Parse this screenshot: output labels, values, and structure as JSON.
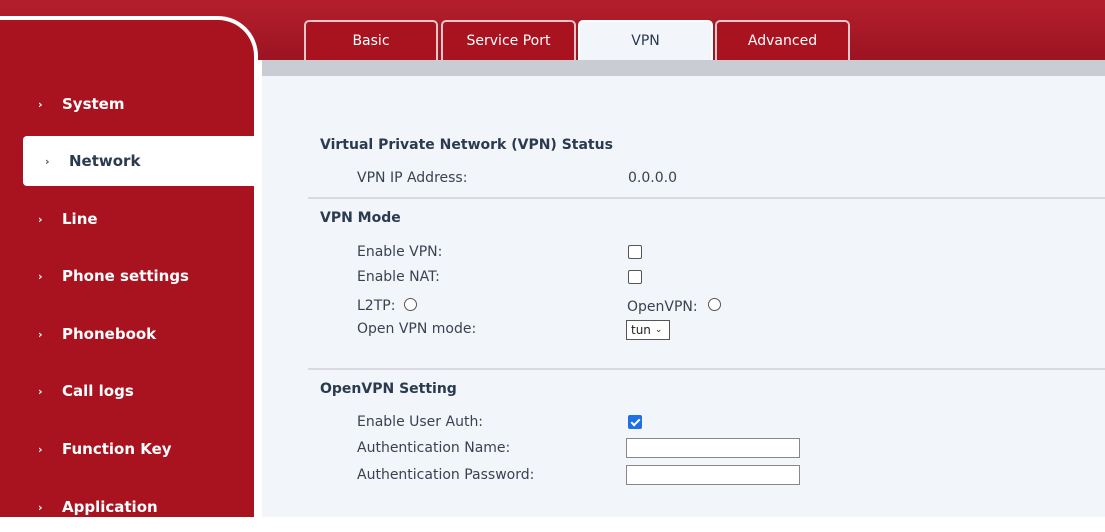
{
  "tabs": [
    {
      "label": "Basic"
    },
    {
      "label": "Service Port"
    },
    {
      "label": "VPN"
    },
    {
      "label": "Advanced"
    }
  ],
  "sidebar": {
    "items": [
      {
        "label": "System"
      },
      {
        "label": "Network"
      },
      {
        "label": "Line"
      },
      {
        "label": "Phone settings"
      },
      {
        "label": "Phonebook"
      },
      {
        "label": "Call logs"
      },
      {
        "label": "Function Key"
      },
      {
        "label": "Application"
      }
    ],
    "chevron": "›"
  },
  "status": {
    "title": "Virtual Private Network (VPN) Status",
    "ip_label": "VPN IP Address:",
    "ip_value": "0.0.0.0"
  },
  "mode": {
    "title": "VPN Mode",
    "enable_vpn_label": "Enable VPN:",
    "enable_vpn_checked": false,
    "enable_nat_label": "Enable NAT:",
    "enable_nat_checked": false,
    "l2tp_label": "L2TP:",
    "openvpn_label": "OpenVPN:",
    "open_vpn_mode_label": "Open VPN mode:",
    "open_vpn_mode_value": "tun"
  },
  "openvpn": {
    "title": "OpenVPN Setting",
    "enable_user_auth_label": "Enable User Auth:",
    "enable_user_auth_checked": true,
    "auth_name_label": "Authentication Name:",
    "auth_name_value": "",
    "auth_password_label": "Authentication Password:",
    "auth_password_value": ""
  },
  "colors": {
    "brand": "#a8131f",
    "content_bg": "#f2f5fa",
    "checkbox_checked": "#1f6fe5"
  }
}
